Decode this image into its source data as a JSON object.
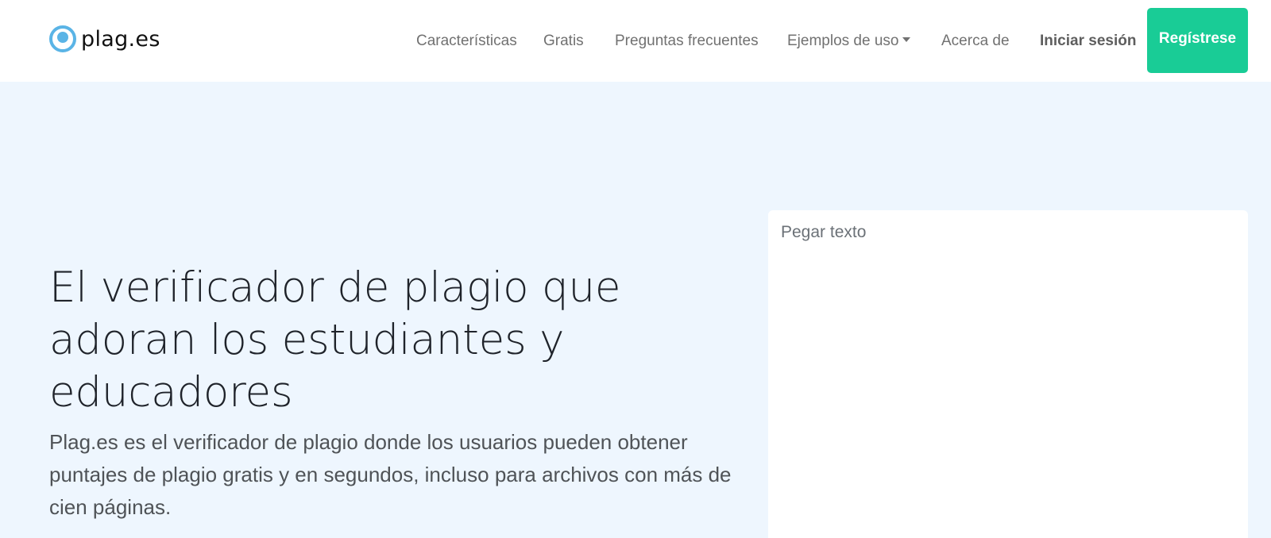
{
  "header": {
    "brand": "plag.es",
    "nav": [
      {
        "id": "features",
        "label": "Características"
      },
      {
        "id": "free",
        "label": "Gratis"
      },
      {
        "id": "faq",
        "label": "Preguntas frecuentes"
      },
      {
        "id": "examples",
        "label": "Ejemplos de uso"
      },
      {
        "id": "about",
        "label": "Acerca de"
      }
    ],
    "login_label": "Iniciar sesión",
    "register_label": "Regístrese"
  },
  "hero": {
    "title": "El verificador de plagio que adoran los estudiantes y educadores",
    "description": "Plag.es es el verificador de plagio donde los usuarios pueden obtener puntajes de plagio gratis y en segundos, incluso para archivos con más de cien páginas."
  },
  "paste": {
    "placeholder": "Pegar texto"
  },
  "colors": {
    "accent": "#19cc96",
    "brand_blue": "#5ab4e6",
    "page_bg": "#eef6fe"
  },
  "icons": {
    "brand": "eye-logo-icon",
    "dropdown": "caret-down-icon"
  }
}
